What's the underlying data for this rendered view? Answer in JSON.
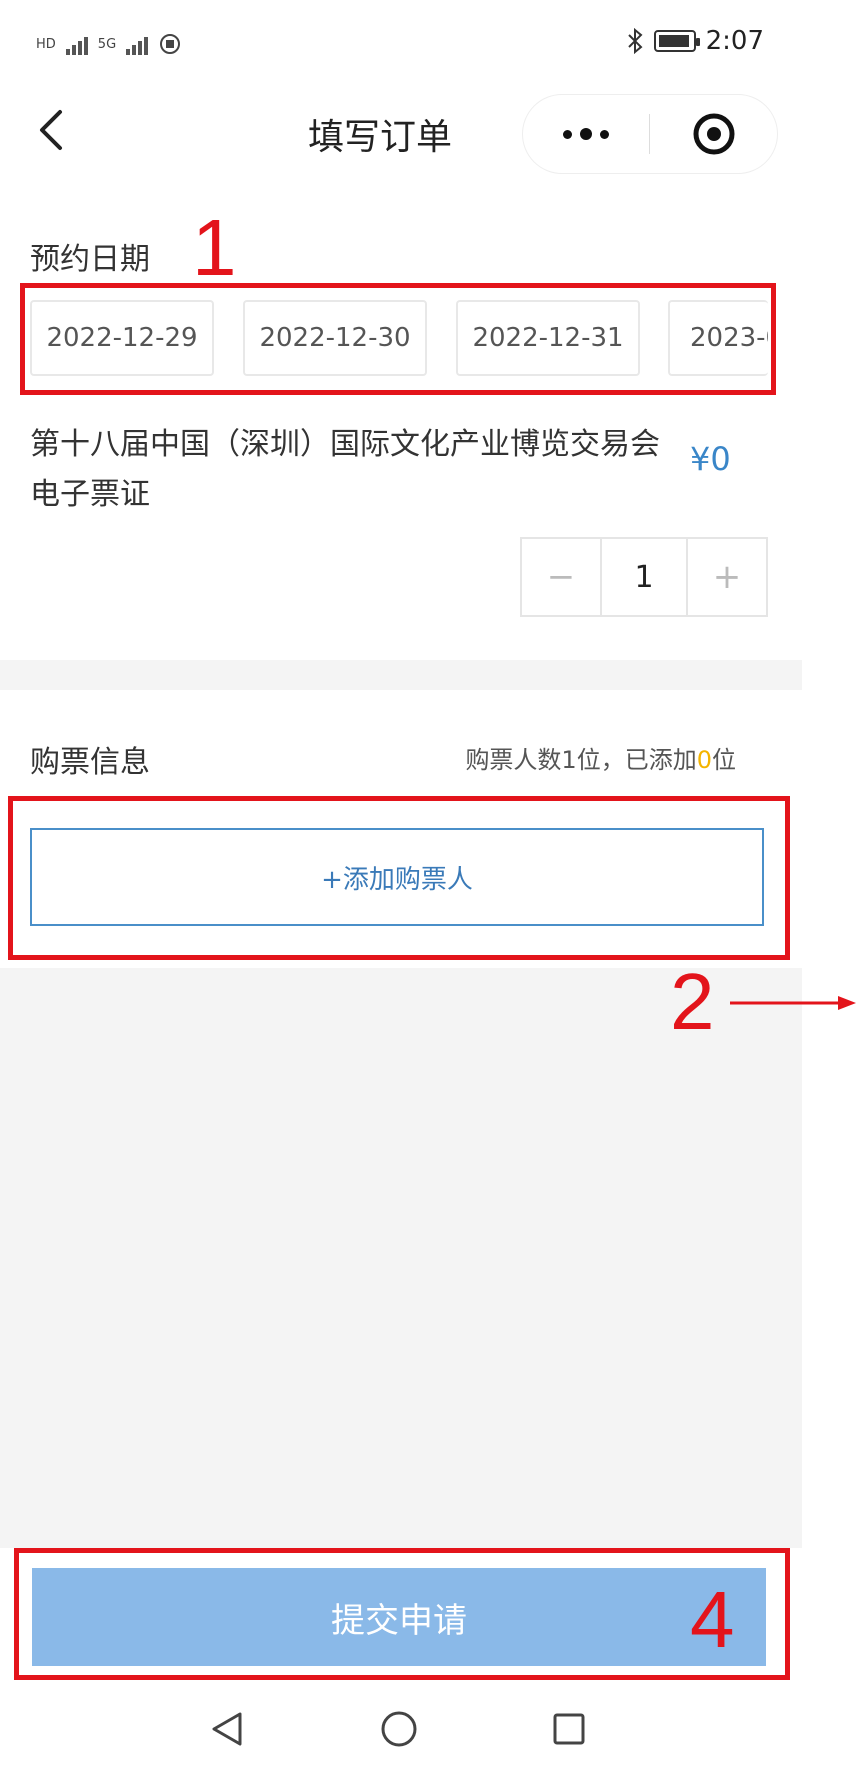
{
  "status_bar": {
    "time": "2:07",
    "left_small_1": "HD",
    "left_small_2": "5G"
  },
  "nav": {
    "title": "填写订单"
  },
  "reservation": {
    "label": "预约日期",
    "dates": [
      "2022-12-29",
      "2022-12-30",
      "2022-12-31",
      "2023-0"
    ]
  },
  "ticket": {
    "name": "第十八届中国（深圳）国际文化产业博览交易会电子票证",
    "price": "¥0",
    "quantity": "1",
    "minus_label": "−",
    "plus_label": "+"
  },
  "purchase_info": {
    "label": "购票信息",
    "count_prefix": "购票人数1位，已添加",
    "count_added": "0",
    "count_suffix": "位",
    "add_button_label": "+添加购票人"
  },
  "submit": {
    "label": "提交申请"
  },
  "annotations": {
    "n1": "1",
    "n2": "2",
    "n4": "4",
    "color": "#e3141b"
  },
  "colors": {
    "accent_blue": "#3a86c8",
    "submit_bg": "#8ab9e8",
    "highlight_yellow": "#f4b400"
  }
}
